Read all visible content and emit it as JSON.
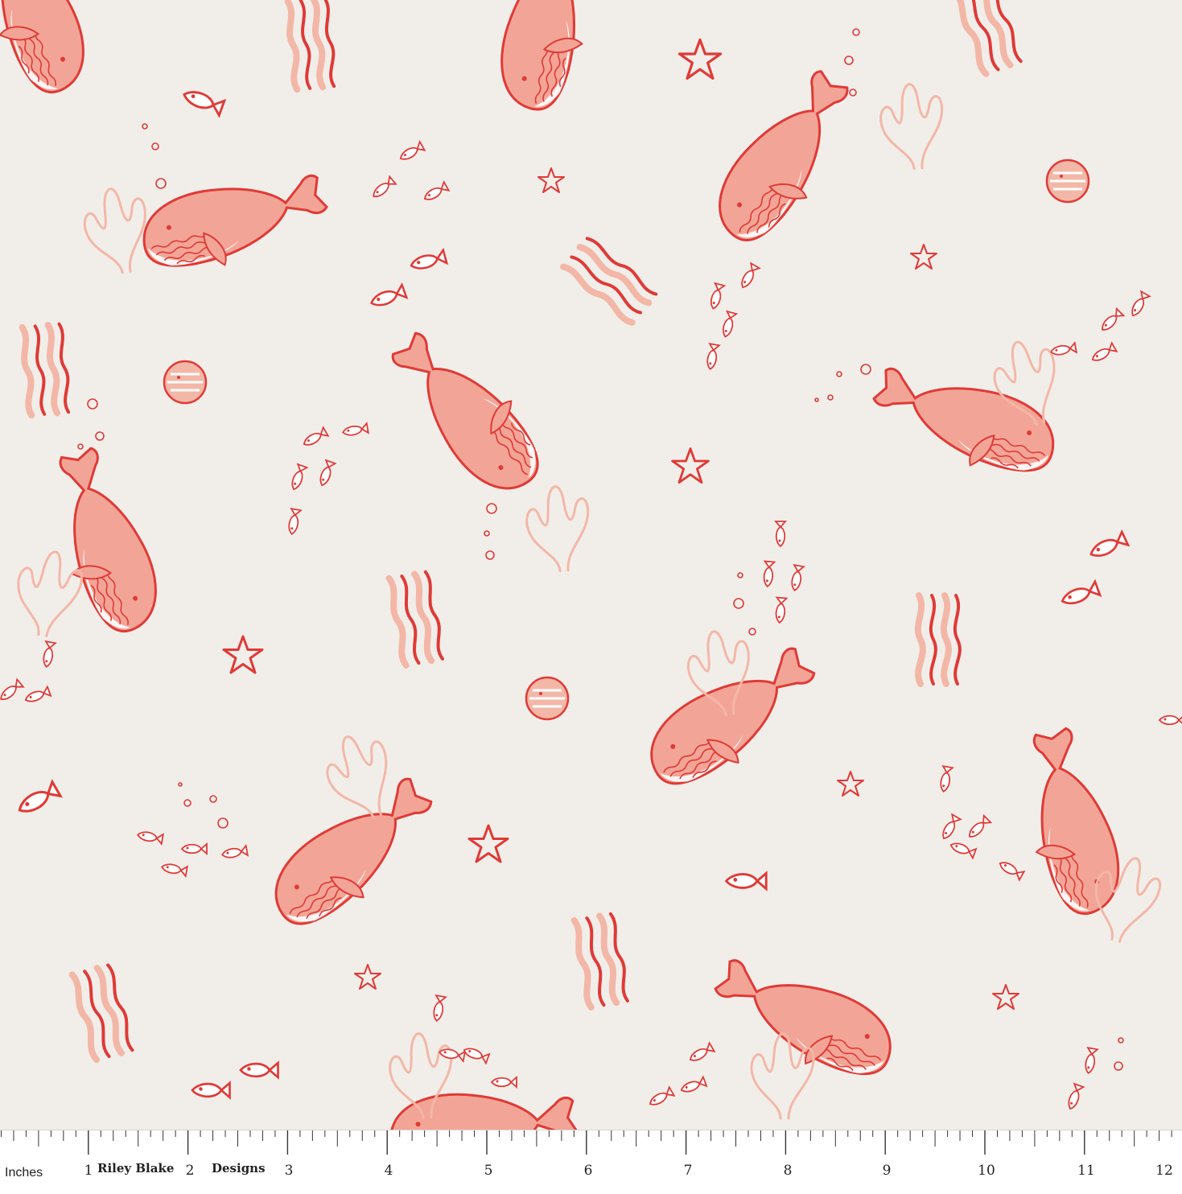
{
  "image": {
    "subject": "Fabric swatch",
    "colors": {
      "background": "#f1eeea",
      "whale_fill": "#f2a597",
      "line_red": "#e03a36",
      "light_coral": "#f3b7a7"
    },
    "motifs": [
      "whale",
      "seaweed",
      "coral",
      "fish",
      "starfish",
      "pufferfish",
      "bubbles"
    ]
  },
  "ruler": {
    "unit_label": "Inches",
    "brand_words": [
      "Riley Blake",
      "Designs"
    ],
    "numbers": [
      "1",
      "2",
      "3",
      "4",
      "5",
      "6",
      "7",
      "8",
      "9",
      "10",
      "11",
      "12"
    ]
  }
}
